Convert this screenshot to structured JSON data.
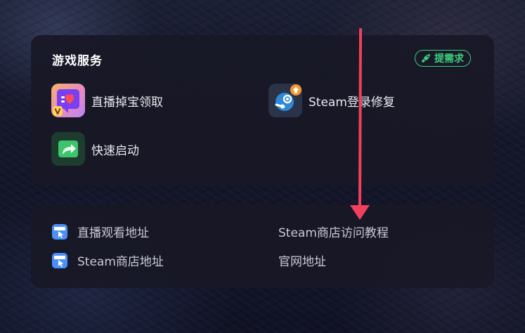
{
  "services": {
    "title": "游戏服务",
    "request_button": "提需求",
    "items": [
      {
        "label": "直播掉宝领取",
        "icon": "gift-icon"
      },
      {
        "label": "Steam登录修复",
        "icon": "steam-icon"
      },
      {
        "label": "快速启动",
        "icon": "quick-launch-icon"
      }
    ]
  },
  "links": {
    "items": [
      {
        "label": "直播观看地址",
        "icon": "www-icon"
      },
      {
        "label": "Steam商店访问教程"
      },
      {
        "label": "Steam商店地址",
        "icon": "www-icon"
      },
      {
        "label": "官网地址"
      }
    ]
  },
  "colors": {
    "accent_green": "#3ad07c",
    "annotation_arrow": "#f0405e",
    "panel": "#181826"
  }
}
